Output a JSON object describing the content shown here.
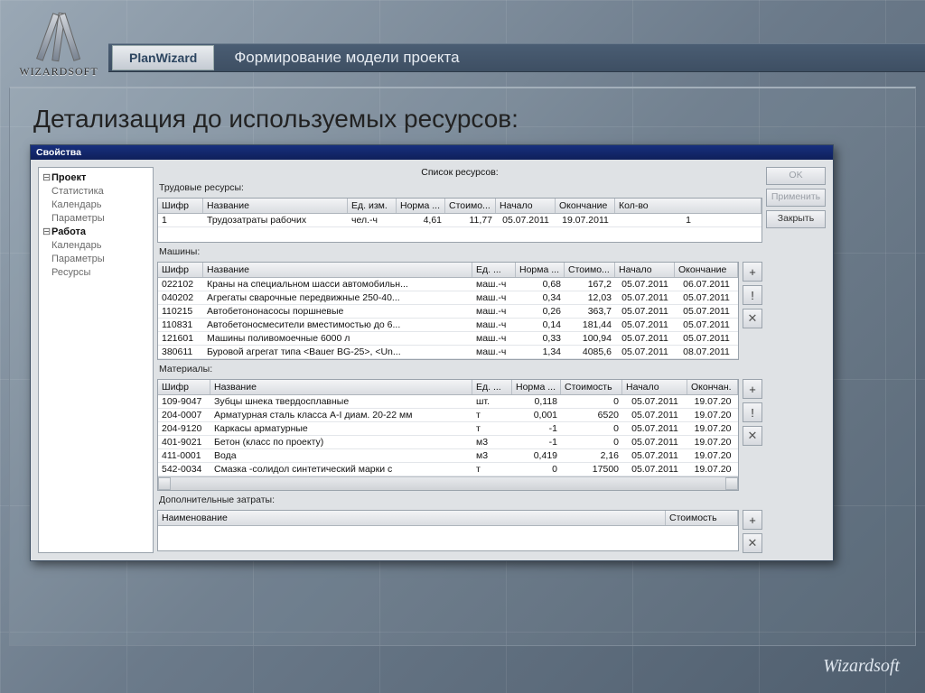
{
  "brand": "WIZARDSOFT",
  "app_badge": "PlanWizard",
  "header_title": "Формирование модели проекта",
  "slide_title": "Детализация до используемых ресурсов:",
  "footer": "Wizardsoft",
  "win": {
    "title": "Свойства",
    "list_title": "Список ресурсов:",
    "buttons": {
      "ok": "OK",
      "apply": "Применить",
      "close": "Закрыть"
    },
    "tree": {
      "project": "Проект",
      "stat": "Статистика",
      "calendar": "Календарь",
      "params": "Параметры",
      "work": "Работа",
      "w_calendar": "Календарь",
      "w_params": "Параметры",
      "w_resources": "Ресурсы"
    },
    "labor": {
      "label": "Трудовые ресурсы:",
      "cols": [
        "Шифр",
        "Название",
        "Ед. изм.",
        "Норма ...",
        "Стоимо...",
        "Начало",
        "Окончание",
        "Кол-во"
      ],
      "rows": [
        [
          "1",
          "Трудозатраты рабочих",
          "чел.-ч",
          "4,61",
          "11,77",
          "05.07.2011",
          "19.07.2011",
          "1"
        ]
      ]
    },
    "machines": {
      "label": "Машины:",
      "cols": [
        "Шифр",
        "Название",
        "Ед. ...",
        "Норма ...",
        "Стоимо...",
        "Начало",
        "Окончание"
      ],
      "rows": [
        [
          "022102",
          "Краны на специальном шасси автомобильн...",
          "маш.-ч",
          "0,68",
          "167,2",
          "05.07.2011",
          "06.07.2011"
        ],
        [
          "040202",
          "Агрегаты сварочные передвижные 250-40...",
          "маш.-ч",
          "0,34",
          "12,03",
          "05.07.2011",
          "05.07.2011"
        ],
        [
          "110215",
          "Автобетононасосы поршневые",
          "маш.-ч",
          "0,26",
          "363,7",
          "05.07.2011",
          "05.07.2011"
        ],
        [
          "110831",
          "Автобетоносмесители вместимостью до 6...",
          "маш.-ч",
          "0,14",
          "181,44",
          "05.07.2011",
          "05.07.2011"
        ],
        [
          "121601",
          "Машины поливомоечные 6000 л",
          "маш.-ч",
          "0,33",
          "100,94",
          "05.07.2011",
          "05.07.2011"
        ],
        [
          "380611",
          "Буровой агрегат типа <Bauer BG-25>, <Un...",
          "маш.-ч",
          "1,34",
          "4085,6",
          "05.07.2011",
          "08.07.2011"
        ]
      ]
    },
    "materials": {
      "label": "Материалы:",
      "cols": [
        "Шифр",
        "Название",
        "Ед. ...",
        "Норма ...",
        "Стоимость",
        "Начало",
        "Окончан."
      ],
      "rows": [
        [
          "109-9047",
          "Зубцы шнека твердосплавные",
          "шт.",
          "0,118",
          "0",
          "05.07.2011",
          "19.07.20"
        ],
        [
          "204-0007",
          "Арматурная сталь класса A-I диам. 20-22 мм",
          "т",
          "0,001",
          "6520",
          "05.07.2011",
          "19.07.20"
        ],
        [
          "204-9120",
          "Каркасы арматурные",
          "т",
          "-1",
          "0",
          "05.07.2011",
          "19.07.20"
        ],
        [
          "401-9021",
          "Бетон (класс по проекту)",
          "м3",
          "-1",
          "0",
          "05.07.2011",
          "19.07.20"
        ],
        [
          "411-0001",
          "Вода",
          "м3",
          "0,419",
          "2,16",
          "05.07.2011",
          "19.07.20"
        ],
        [
          "542-0034",
          "Смазка -солидол синтетический марки с",
          "т",
          "0",
          "17500",
          "05.07.2011",
          "19.07.20"
        ]
      ]
    },
    "additional": {
      "label": "Дополнительные затраты:",
      "cols": [
        "Наименование",
        "Стоимость"
      ]
    }
  }
}
